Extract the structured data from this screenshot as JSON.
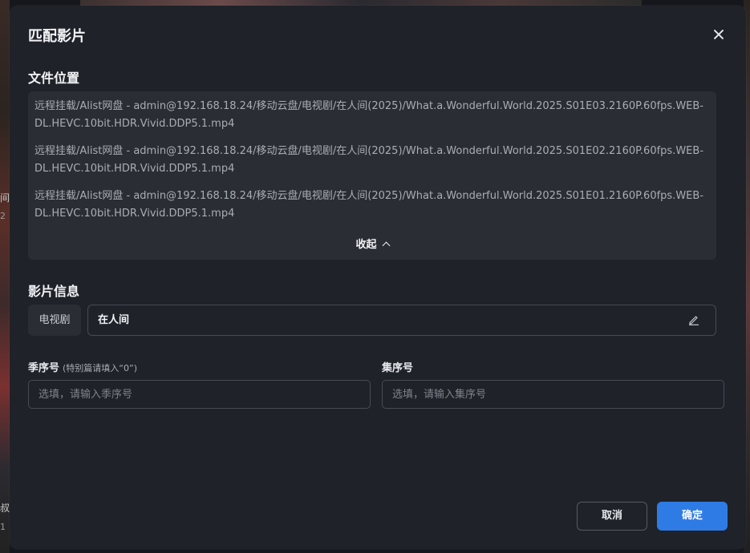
{
  "background": {
    "left_texts": [
      "间",
      "2",
      "叔",
      "1"
    ]
  },
  "dialog": {
    "title": "匹配影片",
    "close_icon": "close-icon"
  },
  "file_location": {
    "title": "文件位置",
    "files": [
      "远程挂载/Alist网盘 - admin@192.168.18.24/移动云盘/电视剧/在人间(2025)/What.a.Wonderful.World.2025.S01E03.2160P.60fps.WEB-DL.HEVC.10bit.HDR.Vivid.DDP5.1.mp4",
      "远程挂载/Alist网盘 - admin@192.168.18.24/移动云盘/电视剧/在人间(2025)/What.a.Wonderful.World.2025.S01E02.2160P.60fps.WEB-DL.HEVC.10bit.HDR.Vivid.DDP5.1.mp4",
      "远程挂载/Alist网盘 - admin@192.168.18.24/移动云盘/电视剧/在人间(2025)/What.a.Wonderful.World.2025.S01E01.2160P.60fps.WEB-DL.HEVC.10bit.HDR.Vivid.DDP5.1.mp4"
    ],
    "collapse_label": "收起"
  },
  "movie_info": {
    "title": "影片信息",
    "type": "电视剧",
    "name": "在人间",
    "edit_icon": "pencil-icon"
  },
  "season": {
    "label": "季序号",
    "hint": "(特别篇请填入“0”)",
    "value": "",
    "placeholder": "选填，请输入季序号"
  },
  "episode": {
    "label": "集序号",
    "value": "",
    "placeholder": "选填，请输入集序号"
  },
  "actions": {
    "cancel": "取消",
    "confirm": "确定"
  },
  "colors": {
    "modal_bg": "#1f2229",
    "panel_bg": "#2a2d33",
    "primary": "#2f7be6",
    "border": "#474b53"
  }
}
